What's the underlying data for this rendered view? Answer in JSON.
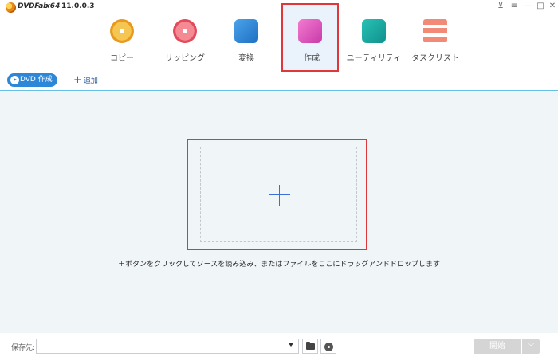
{
  "app": {
    "name": "DVDFab",
    "arch": "x64",
    "version": "11.0.0.3"
  },
  "window_controls": [
    {
      "name": "pin-icon",
      "glyph": "⊻"
    },
    {
      "name": "menu-icon",
      "glyph": "≡"
    },
    {
      "name": "minimize-icon",
      "glyph": "—"
    },
    {
      "name": "maximize-icon",
      "glyph": "□"
    },
    {
      "name": "close-icon",
      "glyph": "✕"
    }
  ],
  "nav": {
    "items": [
      {
        "label": "コピー",
        "icon": "copy-disc-icon",
        "color": "#f0b63a"
      },
      {
        "label": "リッピング",
        "icon": "ripper-disc-icon",
        "color": "#ec5f6e"
      },
      {
        "label": "変換",
        "icon": "converter-film-icon",
        "color": "#2b86d6"
      },
      {
        "label": "作成",
        "icon": "creator-icon",
        "color": "#e046b0",
        "active": true
      },
      {
        "label": "ユーティリティ",
        "icon": "utility-folder-icon",
        "color": "#1aa9a2"
      },
      {
        "label": "タスクリスト",
        "icon": "task-list-icon",
        "color": "#ef7b6b"
      }
    ]
  },
  "toolbar": {
    "dvd_create_label": "DVD 作成",
    "add_label": "追加"
  },
  "main": {
    "hint": "＋ボタンをクリックしてソースを読み込み、またはファイルをここにドラッグアンドドロップします"
  },
  "bottom": {
    "save_label": "保存先:",
    "path_value": "",
    "start_label": "開始",
    "start_menu_glyph": "﹀"
  },
  "colors": {
    "accent": "#2d87d8",
    "highlight": "#e0373b",
    "workspace_bg": "#f0f5f8"
  }
}
